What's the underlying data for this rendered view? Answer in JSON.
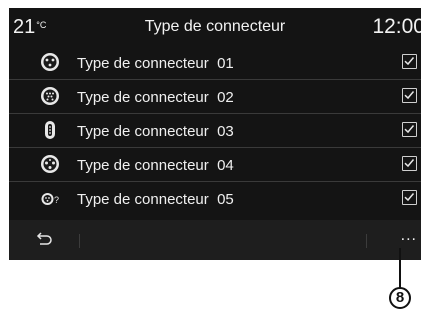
{
  "header": {
    "temperature": "21",
    "temperature_unit": "°C",
    "title": "Type de connecteur",
    "time": "12:00"
  },
  "connectors": [
    {
      "label": "Type de connecteur  01",
      "icon": "connector-type-01-icon",
      "checked": true
    },
    {
      "label": "Type de connecteur  02",
      "icon": "connector-type-02-icon",
      "checked": true
    },
    {
      "label": "Type de connecteur  03",
      "icon": "connector-type-03-icon",
      "checked": true
    },
    {
      "label": "Type de connecteur  04",
      "icon": "connector-type-04-icon",
      "checked": true
    },
    {
      "label": "Type de connecteur  05",
      "icon": "connector-type-05-icon",
      "checked": true
    }
  ],
  "bottom_bar": {
    "back_icon": "back-arrow-icon",
    "more_label": "..."
  },
  "callout": {
    "label": "8"
  }
}
